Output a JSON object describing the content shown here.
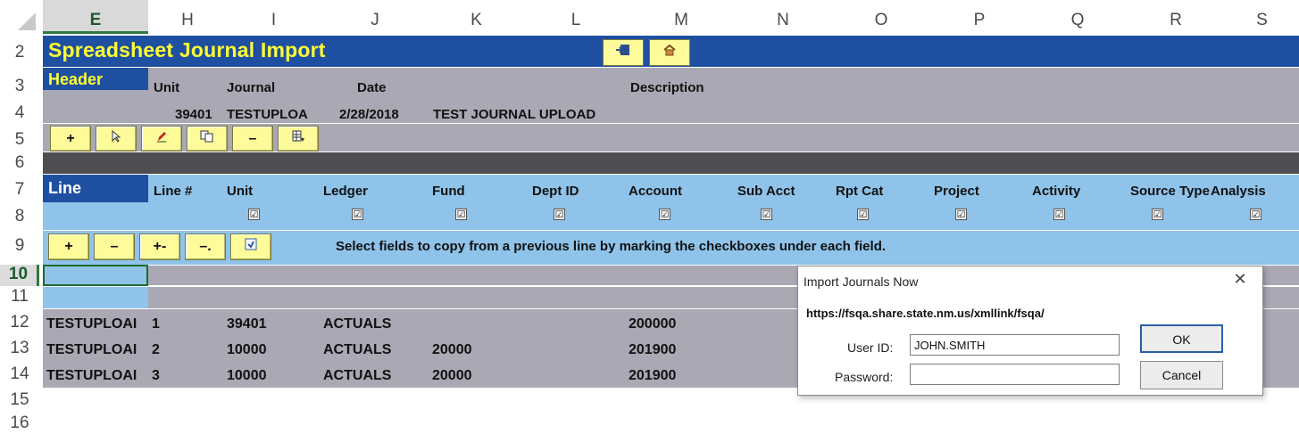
{
  "column_headers": [
    "E",
    "H",
    "I",
    "J",
    "K",
    "L",
    "M",
    "N",
    "O",
    "P",
    "Q",
    "R",
    "S"
  ],
  "row_numbers": [
    "2",
    "3",
    "4",
    "5",
    "6",
    "7",
    "8",
    "9",
    "10",
    "11",
    "12",
    "13",
    "14",
    "15",
    "16"
  ],
  "title": "Spreadsheet Journal Import",
  "top_buttons": {
    "import_icon": "import-icon",
    "home_icon": "home-icon"
  },
  "header": {
    "label": "Header",
    "fields": [
      "Unit",
      "Journal",
      "Date",
      "Description"
    ],
    "values": {
      "unit": "39401",
      "journal": "TESTUPLOA",
      "date": "2/28/2018",
      "description": "TEST JOURNAL UPLOAD"
    }
  },
  "header_toolbar": [
    {
      "label": "+",
      "icon": "add-icon"
    },
    {
      "label": "",
      "icon": "select-icon"
    },
    {
      "label": "",
      "icon": "edit-icon"
    },
    {
      "label": "",
      "icon": "copy-icon"
    },
    {
      "label": "–",
      "icon": "remove-icon"
    },
    {
      "label": "",
      "icon": "grid-icon"
    }
  ],
  "line": {
    "label": "Line",
    "columns": [
      "Line #",
      "Unit",
      "Ledger",
      "Fund",
      "Dept ID",
      "Account",
      "Sub Acct",
      "Rpt Cat",
      "Project",
      "Activity",
      "Source Type",
      "Analysis"
    ],
    "checkbox_mark": "☑",
    "toolbar": [
      {
        "label": "+",
        "icon": "add-line-icon"
      },
      {
        "label": "–",
        "icon": "remove-line-icon"
      },
      {
        "label": "+‐",
        "icon": "insert-line-icon"
      },
      {
        "label": "–.",
        "icon": "delete-line-icon"
      },
      {
        "label": "",
        "icon": "copy-line-icon"
      }
    ],
    "hint": "Select fields to copy from a previous line by marking the checkboxes under each field."
  },
  "rows": [
    {
      "journal": "TESTUPLOAI",
      "line_no": "1",
      "unit": "39401",
      "ledger": "ACTUALS",
      "fund": "",
      "account": "200000"
    },
    {
      "journal": "TESTUPLOAI",
      "line_no": "2",
      "unit": "10000",
      "ledger": "ACTUALS",
      "fund": "20000",
      "account": "201900"
    },
    {
      "journal": "TESTUPLOAI",
      "line_no": "3",
      "unit": "10000",
      "ledger": "ACTUALS",
      "fund": "20000",
      "account": "201900"
    }
  ],
  "dialog": {
    "title": "Import Journals Now",
    "url": "https://fsqa.share.state.nm.us/xmllink/fsqa/",
    "user_label": "User ID:",
    "user_value": "JOHN.SMITH",
    "password_label": "Password:",
    "password_value": "",
    "ok_label": "OK",
    "cancel_label": "Cancel",
    "close_glyph": "✕"
  },
  "colors": {
    "title_band": "#1f4fa0",
    "title_text": "#ffff33",
    "header_band": "#a9a8b4",
    "line_band": "#8fc3ea",
    "button": "#fefb9a"
  }
}
